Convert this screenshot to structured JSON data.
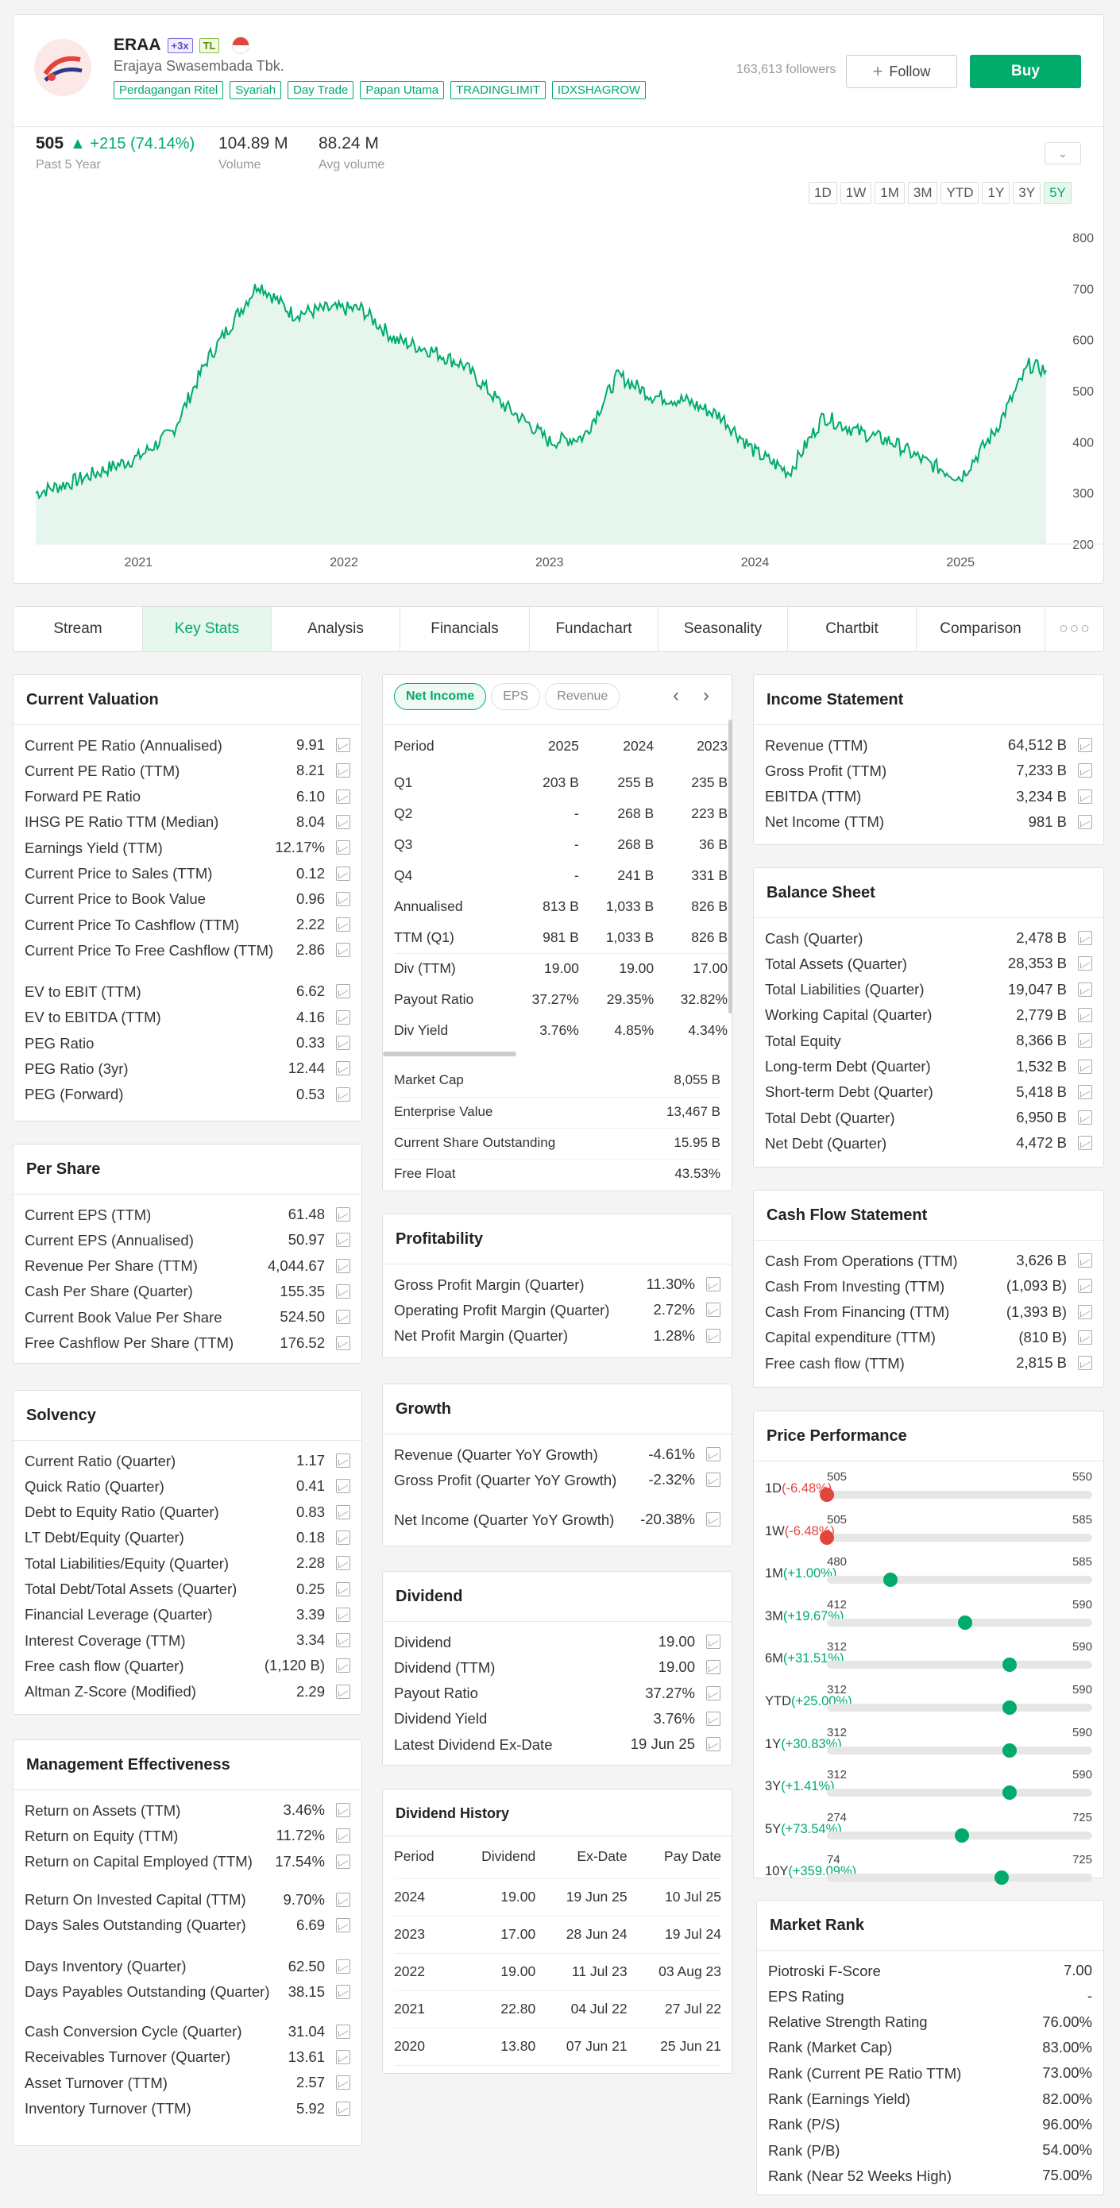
{
  "header": {
    "ticker": "ERAA",
    "badge1": "+3x",
    "badge2": "TL",
    "company": "Erajaya Swasembada Tbk.",
    "tags": [
      "Perdagangan Ritel",
      "Syariah",
      "Day Trade",
      "Papan Utama",
      "TRADINGLIMIT",
      "IDXSHAGROW"
    ],
    "followers": "163,613 followers",
    "follow": "Follow",
    "buy": "Buy"
  },
  "quote": {
    "price": "505",
    "change": "▲ +215 (74.14%)",
    "period": "Past 5 Year",
    "volume": "104.89 M",
    "volume_label": "Volume",
    "avg": "88.24 M",
    "avg_label": "Avg volume"
  },
  "timeframes": [
    "1D",
    "1W",
    "1M",
    "3M",
    "YTD",
    "1Y",
    "3Y",
    "5Y"
  ],
  "chart_data": {
    "type": "area",
    "x": [
      "2020-07",
      "2020-09",
      "2020-11",
      "2021-01",
      "2021-03",
      "2021-05",
      "2021-07",
      "2021-08",
      "2021-10",
      "2021-12",
      "2022-02",
      "2022-04",
      "2022-06",
      "2022-08",
      "2022-10",
      "2022-12",
      "2023-01",
      "2023-03",
      "2023-05",
      "2023-07",
      "2023-09",
      "2023-11",
      "2024-01",
      "2024-03",
      "2024-05",
      "2024-07",
      "2024-09",
      "2024-11",
      "2025-01",
      "2025-03",
      "2025-05",
      "2025-06"
    ],
    "values": [
      300,
      320,
      345,
      370,
      420,
      560,
      660,
      710,
      650,
      660,
      660,
      600,
      580,
      550,
      480,
      430,
      400,
      410,
      530,
      490,
      480,
      450,
      380,
      340,
      450,
      420,
      400,
      360,
      330,
      420,
      550,
      540
    ],
    "ylim": [
      200,
      800
    ],
    "yticks": [
      200,
      300,
      400,
      500,
      600,
      700,
      800
    ],
    "xticks": [
      "2021",
      "2022",
      "2023",
      "2024",
      "2025"
    ],
    "color": "#00ab6b"
  },
  "tabs": [
    "Stream",
    "Key Stats",
    "Analysis",
    "Financials",
    "Fundachart",
    "Seasonality",
    "Chartbit",
    "Comparison"
  ],
  "current_valuation": {
    "title": "Current Valuation",
    "rows": [
      [
        "Current PE Ratio (Annualised)",
        "9.91"
      ],
      [
        "Current PE Ratio (TTM)",
        "8.21"
      ],
      [
        "Forward PE Ratio",
        "6.10"
      ],
      [
        "IHSG PE Ratio TTM (Median)",
        "8.04"
      ],
      [
        "Earnings Yield (TTM)",
        "12.17%"
      ],
      [
        "Current Price to Sales (TTM)",
        "0.12"
      ],
      [
        "Current Price to Book Value",
        "0.96"
      ],
      [
        "Current Price To Cashflow (TTM)",
        "2.22"
      ],
      [
        "Current Price To Free Cashflow (TTM)",
        "2.86"
      ],
      [
        "EV to EBIT (TTM)",
        "6.62"
      ],
      [
        "EV to EBITDA (TTM)",
        "4.16"
      ],
      [
        "PEG Ratio",
        "0.33"
      ],
      [
        "PEG Ratio (3yr)",
        "12.44"
      ],
      [
        "PEG (Forward)",
        "0.53"
      ]
    ]
  },
  "per_share": {
    "title": "Per Share",
    "rows": [
      [
        "Current EPS (TTM)",
        "61.48"
      ],
      [
        "Current EPS (Annualised)",
        "50.97"
      ],
      [
        "Revenue Per Share (TTM)",
        "4,044.67"
      ],
      [
        "Cash Per Share (Quarter)",
        "155.35"
      ],
      [
        "Current Book Value Per Share",
        "524.50"
      ],
      [
        "Free Cashflow Per Share (TTM)",
        "176.52"
      ]
    ]
  },
  "solvency": {
    "title": "Solvency",
    "rows": [
      [
        "Current Ratio (Quarter)",
        "1.17"
      ],
      [
        "Quick Ratio (Quarter)",
        "0.41"
      ],
      [
        "Debt to Equity Ratio (Quarter)",
        "0.83"
      ],
      [
        "LT Debt/Equity (Quarter)",
        "0.18"
      ],
      [
        "Total Liabilities/Equity (Quarter)",
        "2.28"
      ],
      [
        "Total Debt/Total Assets (Quarter)",
        "0.25"
      ],
      [
        "Financial Leverage (Quarter)",
        "3.39"
      ],
      [
        "Interest Coverage (TTM)",
        "3.34"
      ],
      [
        "Free cash flow (Quarter)",
        "(1,120 B)"
      ],
      [
        "Altman Z-Score (Modified)",
        "2.29"
      ]
    ]
  },
  "management": {
    "title": "Management Effectiveness",
    "rows": [
      [
        "Return on Assets (TTM)",
        "3.46%"
      ],
      [
        "Return on Equity (TTM)",
        "11.72%"
      ],
      [
        "Return on Capital Employed (TTM)",
        "17.54%"
      ],
      [
        "Return On Invested Capital (TTM)",
        "9.70%"
      ],
      [
        "Days Sales Outstanding (Quarter)",
        "6.69"
      ],
      [
        "Days Inventory (Quarter)",
        "62.50"
      ],
      [
        "Days Payables Outstanding (Quarter)",
        "38.15"
      ],
      [
        "Cash Conversion Cycle (Quarter)",
        "31.04"
      ],
      [
        "Receivables Turnover (Quarter)",
        "13.61"
      ],
      [
        "Asset Turnover (TTM)",
        "2.57"
      ],
      [
        "Inventory Turnover (TTM)",
        "5.92"
      ]
    ]
  },
  "income_tabs": [
    "Net Income",
    "EPS",
    "Revenue"
  ],
  "income_table": {
    "headers": [
      "Period",
      "2025",
      "2024",
      "2023"
    ],
    "rows": [
      [
        "Q1",
        "203 B",
        "255 B",
        "235 B"
      ],
      [
        "Q2",
        "-",
        "268 B",
        "223 B"
      ],
      [
        "Q3",
        "-",
        "268 B",
        "36 B"
      ],
      [
        "Q4",
        "-",
        "241 B",
        "331 B"
      ],
      [
        "Annualised",
        "813 B",
        "1,033 B",
        "826 B"
      ],
      [
        "TTM (Q1)",
        "981 B",
        "1,033 B",
        "826 B"
      ],
      [
        "Div (TTM)",
        "19.00",
        "19.00",
        "17.00"
      ],
      [
        "Payout Ratio",
        "37.27%",
        "29.35%",
        "32.82%"
      ],
      [
        "Div Yield",
        "3.76%",
        "4.85%",
        "4.34%"
      ]
    ]
  },
  "market_info": {
    "rows": [
      [
        "Market Cap",
        "8,055 B"
      ],
      [
        "Enterprise Value",
        "13,467 B"
      ],
      [
        "Current Share Outstanding",
        "15.95 B"
      ],
      [
        "Free Float",
        "43.53%"
      ]
    ]
  },
  "profitability": {
    "title": "Profitability",
    "rows": [
      [
        "Gross Profit Margin (Quarter)",
        "11.30%"
      ],
      [
        "Operating Profit Margin (Quarter)",
        "2.72%"
      ],
      [
        "Net Profit Margin (Quarter)",
        "1.28%"
      ]
    ]
  },
  "growth": {
    "title": "Growth",
    "rows": [
      [
        "Revenue (Quarter YoY Growth)",
        "-4.61%"
      ],
      [
        "Gross Profit (Quarter YoY Growth)",
        "-2.32%"
      ],
      [
        "Net Income (Quarter YoY Growth)",
        "-20.38%"
      ]
    ]
  },
  "dividend": {
    "title": "Dividend",
    "rows": [
      [
        "Dividend",
        "19.00"
      ],
      [
        "Dividend (TTM)",
        "19.00"
      ],
      [
        "Payout Ratio",
        "37.27%"
      ],
      [
        "Dividend Yield",
        "3.76%"
      ],
      [
        "Latest Dividend Ex-Date",
        "19 Jun 25"
      ]
    ]
  },
  "dividend_history": {
    "title": "Dividend History",
    "headers": [
      "Period",
      "Dividend",
      "Ex-Date",
      "Pay Date"
    ],
    "rows": [
      [
        "2024",
        "19.00",
        "19 Jun 25",
        "10 Jul 25"
      ],
      [
        "2023",
        "17.00",
        "28 Jun 24",
        "19 Jul 24"
      ],
      [
        "2022",
        "19.00",
        "11 Jul 23",
        "03 Aug 23"
      ],
      [
        "2021",
        "22.80",
        "04 Jul 22",
        "27 Jul 22"
      ],
      [
        "2020",
        "13.80",
        "07 Jun 21",
        "25 Jun 21"
      ]
    ]
  },
  "income_statement": {
    "title": "Income Statement",
    "rows": [
      [
        "Revenue (TTM)",
        "64,512 B"
      ],
      [
        "Gross Profit (TTM)",
        "7,233 B"
      ],
      [
        "EBITDA (TTM)",
        "3,234 B"
      ],
      [
        "Net Income (TTM)",
        "981 B"
      ]
    ]
  },
  "balance_sheet": {
    "title": "Balance Sheet",
    "rows": [
      [
        "Cash (Quarter)",
        "2,478 B"
      ],
      [
        "Total Assets (Quarter)",
        "28,353 B"
      ],
      [
        "Total Liabilities (Quarter)",
        "19,047 B"
      ],
      [
        "Working Capital (Quarter)",
        "2,779 B"
      ],
      [
        "Total Equity",
        "8,366 B"
      ],
      [
        "Long-term Debt (Quarter)",
        "1,532 B"
      ],
      [
        "Short-term Debt (Quarter)",
        "5,418 B"
      ],
      [
        "Total Debt (Quarter)",
        "6,950 B"
      ],
      [
        "Net Debt (Quarter)",
        "4,472 B"
      ]
    ]
  },
  "cash_flow": {
    "title": "Cash Flow Statement",
    "rows": [
      [
        "Cash From Operations (TTM)",
        "3,626 B"
      ],
      [
        "Cash From Investing (TTM)",
        "(1,093 B)"
      ],
      [
        "Cash From Financing (TTM)",
        "(1,393 B)"
      ],
      [
        "Capital expenditure (TTM)",
        "(810 B)"
      ],
      [
        "Free cash flow (TTM)",
        "2,815 B"
      ]
    ]
  },
  "price_performance": {
    "title": "Price Performance",
    "rows": [
      {
        "label": "1D",
        "chg": "(-6.48%)",
        "low": "505",
        "high": "550",
        "pos": 0.0,
        "neg": true
      },
      {
        "label": "1W",
        "chg": "(-6.48%)",
        "low": "505",
        "high": "585",
        "pos": 0.0,
        "neg": true
      },
      {
        "label": "1M",
        "chg": "(+1.00%)",
        "low": "480",
        "high": "585",
        "pos": 0.24,
        "neg": false
      },
      {
        "label": "3M",
        "chg": "(+19.67%)",
        "low": "412",
        "high": "590",
        "pos": 0.52,
        "neg": false
      },
      {
        "label": "6M",
        "chg": "(+31.51%)",
        "low": "312",
        "high": "590",
        "pos": 0.69,
        "neg": false
      },
      {
        "label": "YTD",
        "chg": "(+25.00%)",
        "low": "312",
        "high": "590",
        "pos": 0.69,
        "neg": false
      },
      {
        "label": "1Y",
        "chg": "(+30.83%)",
        "low": "312",
        "high": "590",
        "pos": 0.69,
        "neg": false
      },
      {
        "label": "3Y",
        "chg": "(+1.41%)",
        "low": "312",
        "high": "590",
        "pos": 0.69,
        "neg": false
      },
      {
        "label": "5Y",
        "chg": "(+73.54%)",
        "low": "274",
        "high": "725",
        "pos": 0.51,
        "neg": false
      },
      {
        "label": "10Y",
        "chg": "(+359.09%)",
        "low": "74",
        "high": "725",
        "pos": 0.66,
        "neg": false
      }
    ]
  },
  "market_rank": {
    "title": "Market Rank",
    "rows": [
      [
        "Piotroski F-Score",
        "7.00"
      ],
      [
        "EPS Rating",
        "-"
      ],
      [
        "Relative Strength Rating",
        "76.00%"
      ],
      [
        "Rank (Market Cap)",
        "83.00%"
      ],
      [
        "Rank (Current PE Ratio TTM)",
        "73.00%"
      ],
      [
        "Rank (Earnings Yield)",
        "82.00%"
      ],
      [
        "Rank (P/S)",
        "96.00%"
      ],
      [
        "Rank (P/B)",
        "54.00%"
      ],
      [
        "Rank (Near 52 Weeks High)",
        "75.00%"
      ]
    ]
  }
}
